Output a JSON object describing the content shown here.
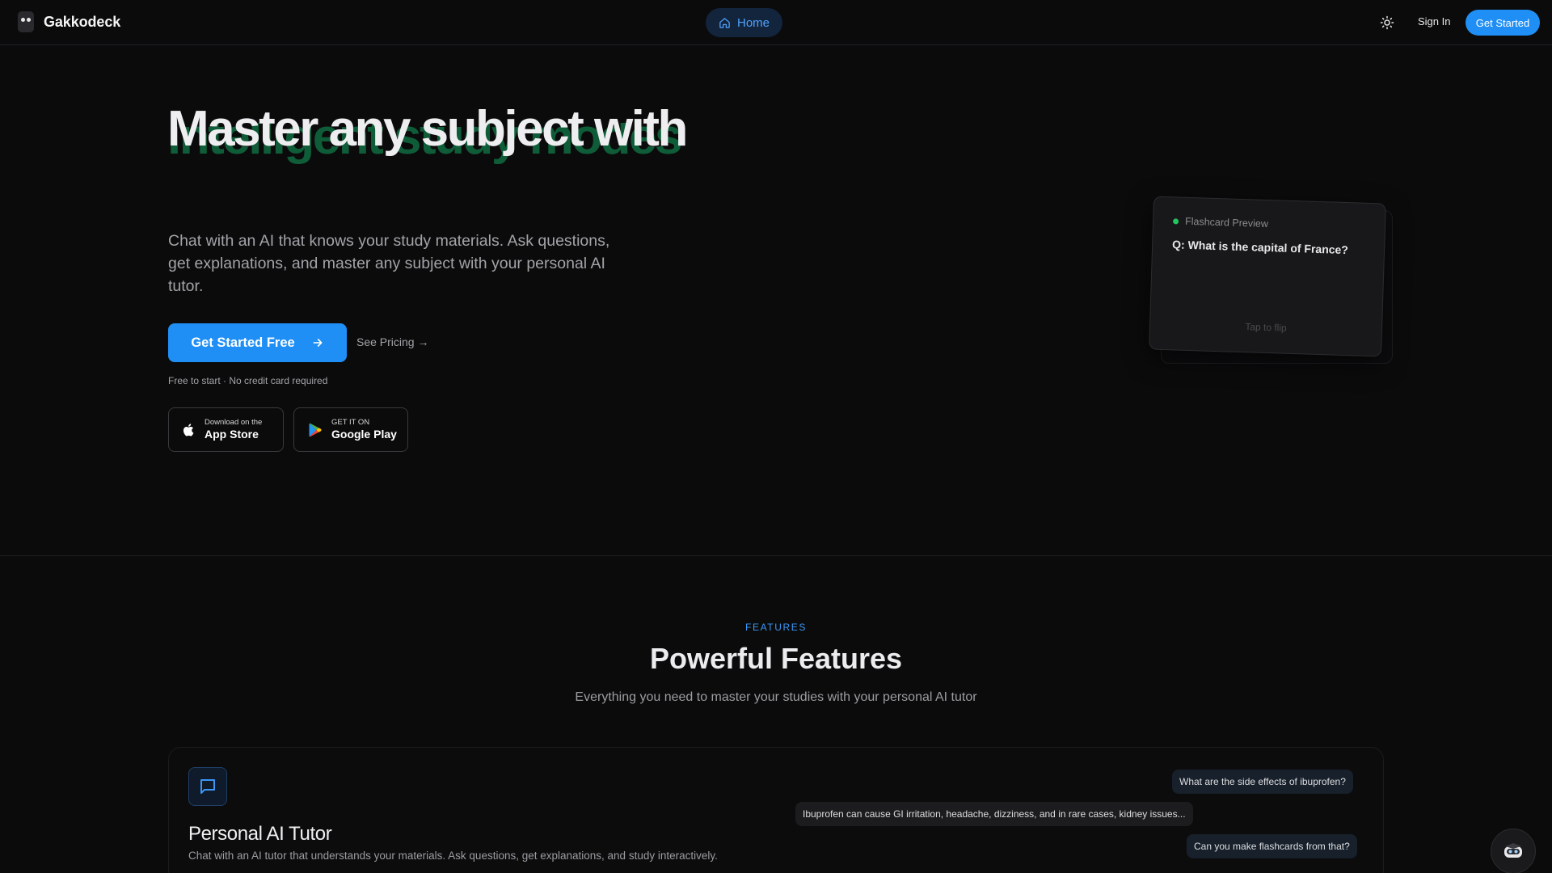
{
  "nav": {
    "brand": "Gakkodeck",
    "home_label": "Home",
    "sign_in": "Sign In",
    "cta": "Get Started",
    "icons": {
      "logo": "robot-logo",
      "home": "home-icon",
      "theme": "sun-icon"
    }
  },
  "hero": {
    "title_line1": "Master any subject with",
    "title_line2": "intelligent study modes",
    "subtitle": "Chat with an AI that knows your study materials. Ask questions, get explanations, and master any subject with your personal AI tutor.",
    "cta_primary": "Get Started Free",
    "cta_secondary": "See Pricing →",
    "note": "Free to start · No credit card required",
    "app_store": {
      "small": "Download on the",
      "big": "App Store"
    },
    "google_play": {
      "small": "GET IT ON",
      "big": "Google Play"
    }
  },
  "flashcard": {
    "label": "Flashcard Preview",
    "question": "Q: What is the capital of France?",
    "hint": "Tap to flip"
  },
  "features": {
    "eyebrow": "FEATURES",
    "title": "Powerful Features",
    "subtitle": "Everything you need to master your studies with your personal AI tutor",
    "items": [
      {
        "name": "Personal AI Tutor",
        "description": "Chat with an AI tutor that understands your materials. Ask questions, get explanations, and study interactively.",
        "icon": "chat-bubble-icon"
      }
    ],
    "chat": [
      "What are the side effects of ibuprofen?",
      "Ibuprofen can cause GI irritation, headache, dizziness, and in rare cases, kidney issues...",
      "Can you make flashcards from that?"
    ]
  },
  "colors": {
    "background": "#0b0b0c",
    "accent": "#1f8ff5",
    "green_title": "#0f5c38",
    "muted_text": "#a3a3a8"
  }
}
